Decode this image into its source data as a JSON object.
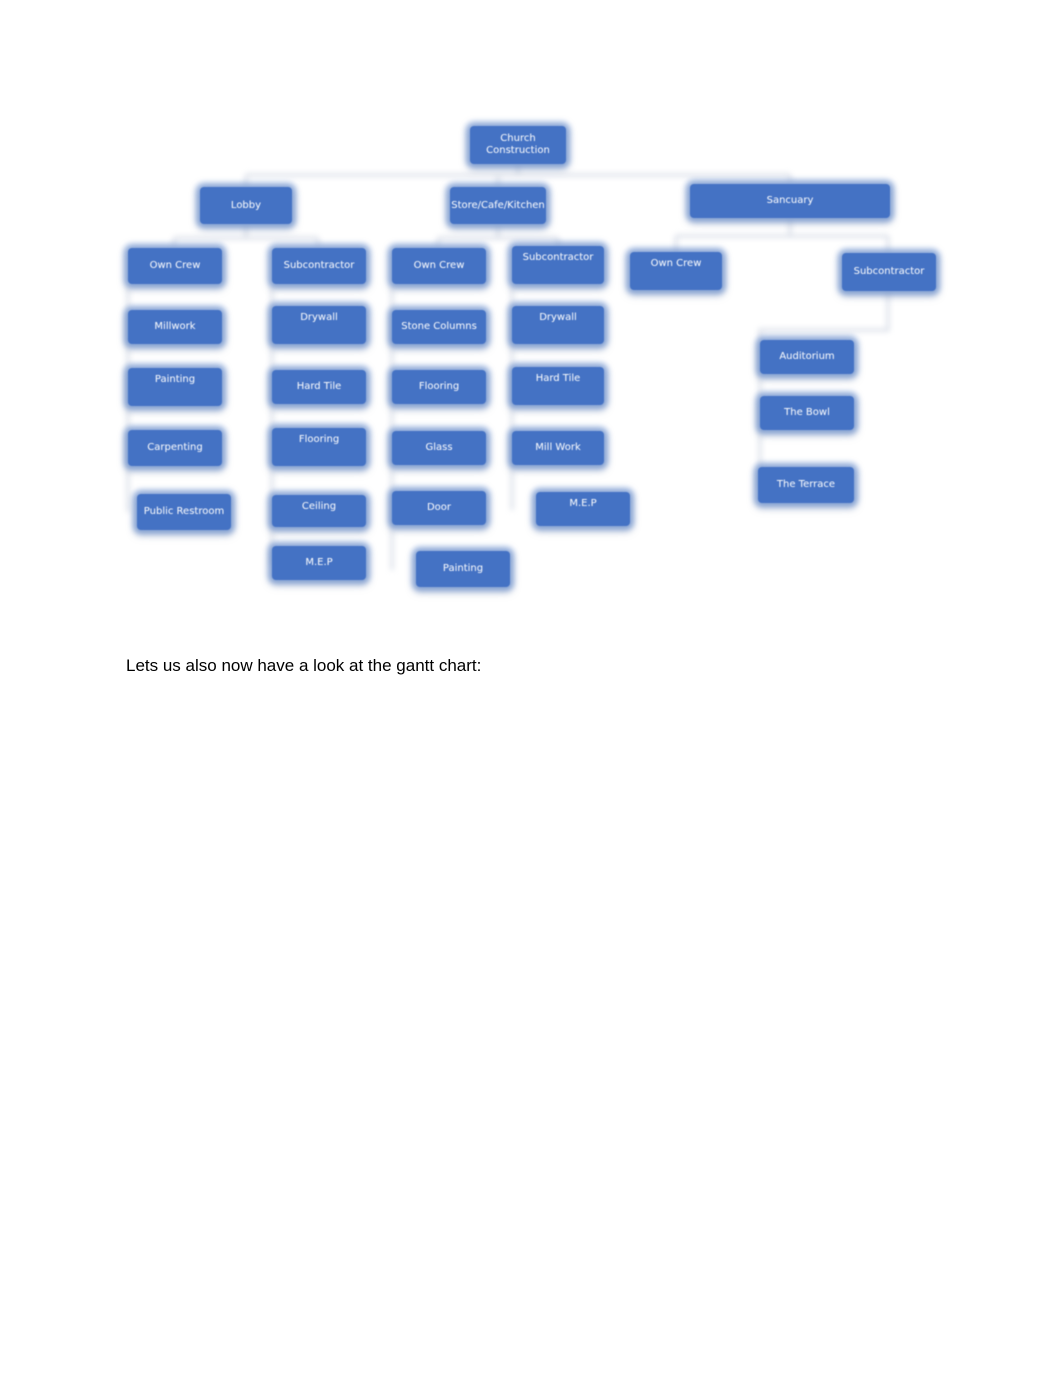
{
  "diagram": {
    "type": "org-chart",
    "node_color": "#4472c4",
    "text_color": "#ffffff",
    "root": {
      "label_line1": "Church",
      "label_line2": "Construction"
    },
    "branches": {
      "lobby": {
        "label": "Lobby",
        "own_crew": {
          "label": "Own Crew",
          "items": [
            "Millwork",
            "Painting",
            "Carpenting",
            "Public Restroom"
          ]
        },
        "subcontractor": {
          "label": "Subcontractor",
          "items": [
            "Drywall",
            "Hard Tile",
            "Flooring",
            "Ceiling",
            "M.E.P"
          ]
        }
      },
      "store": {
        "label": "Store/Cafe/Kitchen",
        "own_crew": {
          "label": "Own Crew",
          "items": [
            "Stone Columns",
            "Flooring",
            "Glass",
            "Door",
            "Painting"
          ]
        },
        "subcontractor": {
          "label": "Subcontractor",
          "items": [
            "Drywall",
            "Hard Tile",
            "Mill Work",
            "M.E.P"
          ]
        }
      },
      "sanctuary": {
        "label": "Sancuary",
        "own_crew": {
          "label": "Own Crew",
          "items": []
        },
        "subcontractor": {
          "label": "Subcontractor",
          "items": [
            "Auditorium",
            "The Bowl",
            "The Terrace"
          ]
        }
      }
    }
  },
  "caption": "Lets us also now have a look at the gantt chart:"
}
